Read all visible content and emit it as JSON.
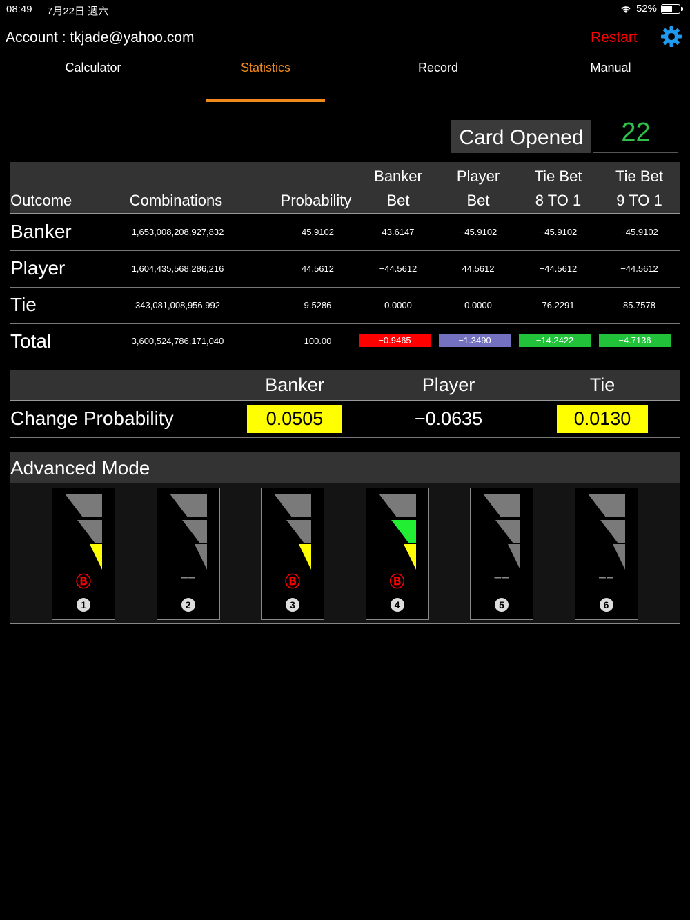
{
  "status": {
    "time": "08:49",
    "date": "7月22日 週六",
    "battery": "52%"
  },
  "account_label": "Account : tkjade@yahoo.com",
  "restart_label": "Restart",
  "tabs": [
    {
      "label": "Calculator",
      "active": false
    },
    {
      "label": "Statistics",
      "active": true
    },
    {
      "label": "Record",
      "active": false
    },
    {
      "label": "Manual",
      "active": false
    }
  ],
  "card_opened": {
    "label": "Card Opened",
    "value": "22"
  },
  "table": {
    "headers": {
      "outcome": "Outcome",
      "combinations": "Combinations",
      "probability": "Probability",
      "banker_bet_1": "Banker",
      "banker_bet_2": "Bet",
      "player_bet_1": "Player",
      "player_bet_2": "Bet",
      "tie8_1": "Tie Bet",
      "tie8_2": "8 TO 1",
      "tie9_1": "Tie Bet",
      "tie9_2": "9 TO 1"
    },
    "rows": [
      {
        "outcome": "Banker",
        "combinations": "1,653,008,208,927,832",
        "probability": "45.9102",
        "banker_bet": "43.6147",
        "player_bet": "−45.9102",
        "tie8": "−45.9102",
        "tie9": "−45.9102"
      },
      {
        "outcome": "Player",
        "combinations": "1,604,435,568,286,216",
        "probability": "44.5612",
        "banker_bet": "−44.5612",
        "player_bet": "44.5612",
        "tie8": "−44.5612",
        "tie9": "−44.5612"
      },
      {
        "outcome": "Tie",
        "combinations": "343,081,008,956,992",
        "probability": "9.5286",
        "banker_bet": "0.0000",
        "player_bet": "0.0000",
        "tie8": "76.2291",
        "tie9": "85.7578"
      }
    ],
    "total": {
      "outcome": "Total",
      "combinations": "3,600,524,786,171,040",
      "probability": "100.00",
      "banker_bet": "−0.9465",
      "player_bet": "−1.3490",
      "tie8": "−14.2422",
      "tie9": "−4.7136"
    },
    "total_colors": {
      "banker_bet": "#ff0000",
      "player_bet": "#7472c0",
      "tie8": "#21c23a",
      "tie9": "#21c23a"
    }
  },
  "change_probability": {
    "label": "Change Probability",
    "headers": {
      "banker": "Banker",
      "player": "Player",
      "tie": "Tie"
    },
    "banker": "0.0505",
    "player": "−0.0635",
    "tie": "0.0130",
    "highlight_color": "#ffff00"
  },
  "advanced_mode": {
    "label": "Advanced Mode",
    "meters": [
      {
        "number": "1",
        "mark": "B",
        "levels": [
          "gray",
          "gray",
          "yellow"
        ]
      },
      {
        "number": "2",
        "mark": "––",
        "levels": [
          "gray",
          "gray",
          "gray"
        ]
      },
      {
        "number": "3",
        "mark": "B",
        "levels": [
          "gray",
          "gray",
          "yellow"
        ]
      },
      {
        "number": "4",
        "mark": "B",
        "levels": [
          "gray",
          "green",
          "yellow"
        ]
      },
      {
        "number": "5",
        "mark": "––",
        "levels": [
          "gray",
          "gray",
          "gray"
        ]
      },
      {
        "number": "6",
        "mark": "––",
        "levels": [
          "gray",
          "gray",
          "gray"
        ]
      }
    ]
  }
}
